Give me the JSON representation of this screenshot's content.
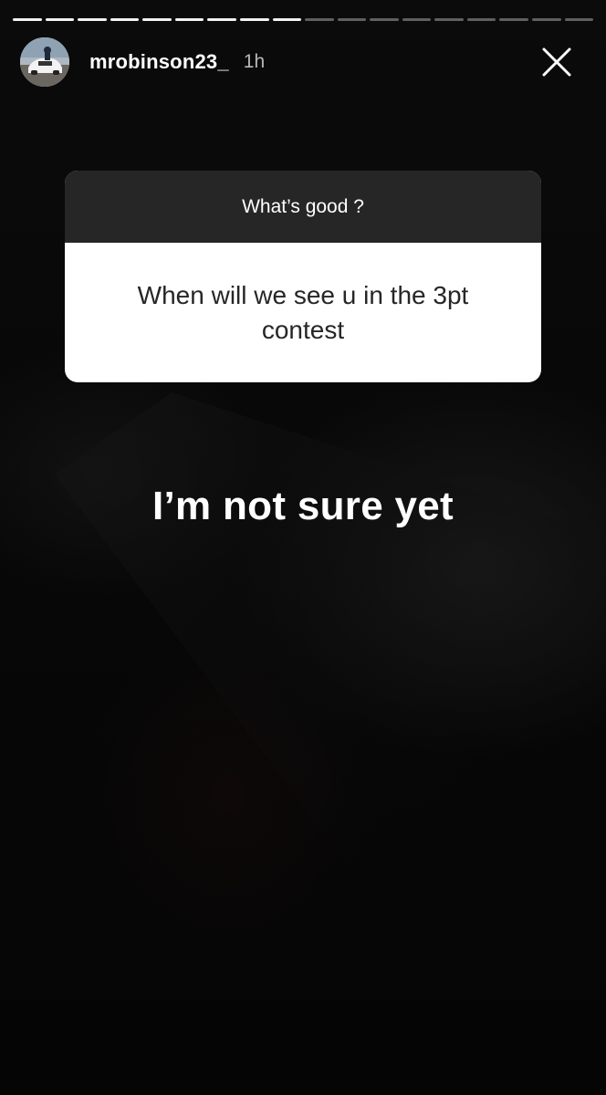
{
  "progress": {
    "segments_total": 18,
    "segments_seen": 9
  },
  "header": {
    "username": "mrobinson23_",
    "time_ago": "1h",
    "avatar_icon": "profile-photo-car",
    "close_icon": "close-x-icon"
  },
  "question_sticker": {
    "prompt": "What’s good ?",
    "question": "When will we see u in the 3pt contest"
  },
  "answer_text": "I’m not sure yet",
  "colors": {
    "sticker_header_bg": "#262626",
    "sticker_body_bg": "#ffffff",
    "text_light": "#ffffff",
    "text_dark": "#262626"
  }
}
